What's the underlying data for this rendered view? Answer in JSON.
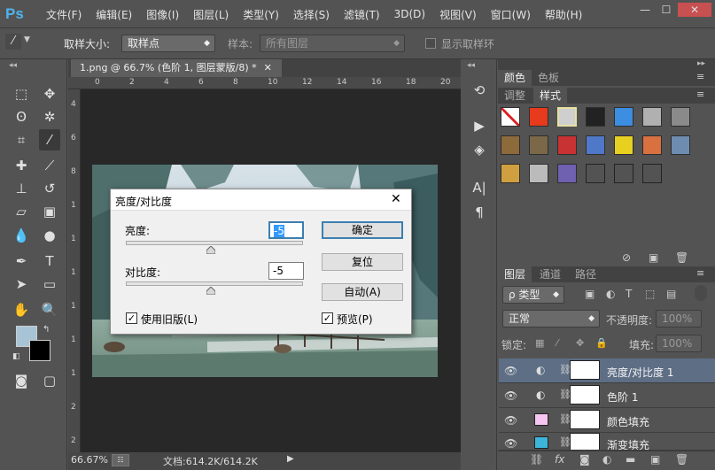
{
  "app": {
    "logo": "Ps"
  },
  "menu": [
    "文件(F)",
    "编辑(E)",
    "图像(I)",
    "图层(L)",
    "类型(Y)",
    "选择(S)",
    "滤镜(T)",
    "3D(D)",
    "视图(V)",
    "窗口(W)",
    "帮助(H)"
  ],
  "options": {
    "sample_size_label": "取样大小:",
    "sample_size_value": "取样点",
    "sample_label": "样本:",
    "sample_value": "所有图层",
    "show_ring_label": "显示取样环"
  },
  "document": {
    "tab_title": "1.png @ 66.7% (色阶 1, 图层蒙版/8) *",
    "ruler_h": [
      "0",
      "2",
      "4",
      "6",
      "8",
      "10",
      "12",
      "14",
      "16",
      "18",
      "20"
    ],
    "ruler_v": [
      "4",
      "6",
      "8",
      "1",
      "1",
      "1",
      "1",
      "1",
      "1",
      "2",
      "2"
    ],
    "zoom": "66.67%",
    "doc_info": "文档:614.2K/614.2K"
  },
  "panels": {
    "color_tabs": [
      "颜色",
      "色板"
    ],
    "style_tabs": [
      "调整",
      "样式"
    ],
    "layer_tabs": [
      "图层",
      "通道",
      "路径"
    ],
    "kind_label": "ρ 类型",
    "blend_mode": "正常",
    "opacity_label": "不透明度:",
    "opacity_value": "100%",
    "lock_label": "锁定:",
    "fill_label": "填充:",
    "fill_value": "100%",
    "style_swatches": [
      "#ffffff",
      "#e83a1c",
      "#cfcfcf",
      "#222222",
      "#3c8ee0",
      "#b0b0b0",
      "#8a8a8a",
      "#8c6a3a",
      "#7a6848",
      "#c83232",
      "#5078c8",
      "#e8d020",
      "#d87040",
      "#6e8cb0",
      "#d0a040",
      "#bbbbbb",
      "#7060b0",
      "#4a4a4a",
      "#555555",
      "#555555"
    ]
  },
  "layers": [
    {
      "name": "亮度/对比度 1",
      "active": true
    },
    {
      "name": "色阶 1",
      "active": false
    },
    {
      "name": "颜色填充",
      "active": false
    },
    {
      "name": "渐变填充",
      "active": false
    }
  ],
  "dialog": {
    "title": "亮度/对比度",
    "brightness_label": "亮度:",
    "brightness_value": "-5",
    "contrast_label": "对比度:",
    "contrast_value": "-5",
    "brightness_fraction": 0.48,
    "contrast_fraction": 0.48,
    "ok_label": "确定",
    "reset_label": "复位",
    "auto_label": "自动(A)",
    "legacy_label": "使用旧版(L)",
    "preview_label": "预览(P)"
  }
}
